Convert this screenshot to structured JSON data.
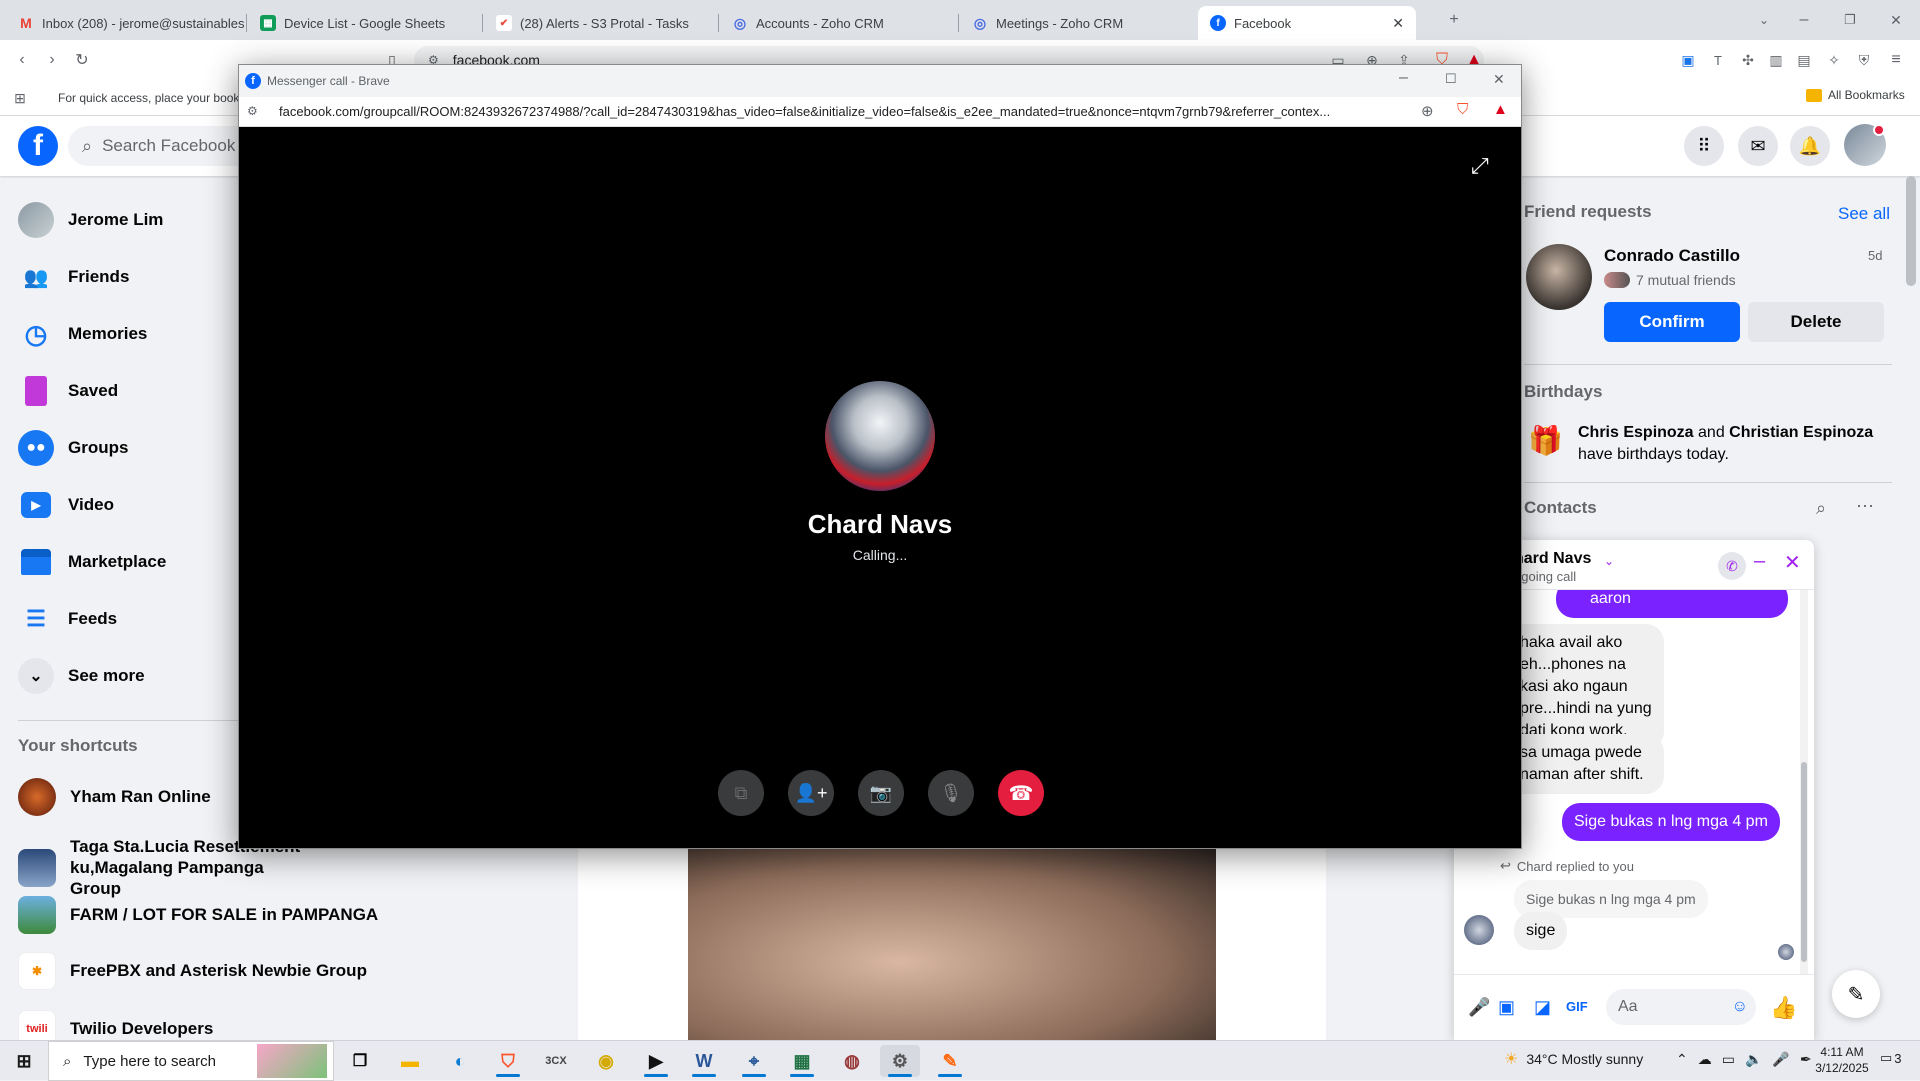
{
  "browser": {
    "tabs": [
      {
        "label": "Inbox (208) - jerome@sustainablesp",
        "icon": "gmail-icon",
        "color": "#ea4335"
      },
      {
        "label": "Device List - Google Sheets",
        "icon": "sheets-icon",
        "color": "#0f9d58"
      },
      {
        "label": "(28) Alerts - S3 Protal - Tasks",
        "icon": "tasks-icon",
        "color": "#e94b3c"
      },
      {
        "label": "Accounts - Zoho CRM",
        "icon": "zoho-icon",
        "color": "#4a6ee0"
      },
      {
        "label": "Meetings - Zoho CRM",
        "icon": "zoho-icon",
        "color": "#4a6ee0"
      },
      {
        "label": "Facebook",
        "icon": "facebook-icon",
        "color": "#0866ff"
      }
    ],
    "address": "facebook.com",
    "bookmarks_hint": "For quick access, place your bookm",
    "all_bookmarks": "All Bookmarks"
  },
  "facebook": {
    "search_placeholder": "Search Facebook",
    "nav": [
      {
        "label": "Jerome Lim",
        "icon": "avatar"
      },
      {
        "label": "Friends",
        "icon": "friends-icon"
      },
      {
        "label": "Memories",
        "icon": "memories-icon"
      },
      {
        "label": "Saved",
        "icon": "saved-icon"
      },
      {
        "label": "Groups",
        "icon": "groups-icon"
      },
      {
        "label": "Video",
        "icon": "video-icon"
      },
      {
        "label": "Marketplace",
        "icon": "marketplace-icon"
      },
      {
        "label": "Feeds",
        "icon": "feeds-icon"
      },
      {
        "label": "See more",
        "icon": "chevron-down-icon"
      }
    ],
    "shortcuts_title": "Your shortcuts",
    "shortcuts": [
      {
        "label": "Yham Ran Online"
      },
      {
        "label": "Taga Sta.Lucia Resettlement ku,Magalang Pampanga Group"
      },
      {
        "label": "FARM / LOT FOR SALE in PAMPANGA"
      },
      {
        "label": "FreePBX and Asterisk Newbie Group"
      },
      {
        "label": "Twilio Developers"
      }
    ],
    "friend_requests": {
      "title": "Friend requests",
      "see_all": "See all",
      "name": "Conrado Castillo",
      "age": "5d",
      "mutual": "7 mutual friends",
      "confirm": "Confirm",
      "delete": "Delete"
    },
    "birthdays": {
      "title": "Birthdays",
      "name1": "Chris Espinoza",
      "and": " and ",
      "name2": "Christian Espinoza",
      "rest": "have birthdays today."
    },
    "contacts_title": "Contacts"
  },
  "chat": {
    "name": "hard Navs",
    "status": "ngoing call",
    "messages": {
      "out_top": "aaron",
      "in1": "haka avail ako eh...phones na kasi ako ngaun pre...hindi na yung dati kong work.",
      "in2": "sa umaga pwede naman after shift.",
      "out1": "Sige bukas n lng mga 4 pm",
      "reply_note": "Chard replied to you",
      "quoted": "Sige bukas n lng mga 4 pm",
      "in3": "sige"
    },
    "composer_placeholder": "Aa"
  },
  "popup": {
    "title": "Messenger call - Brave",
    "url": "facebook.com/groupcall/ROOM:8243932672374988/?call_id=2847430319&has_video=false&initialize_video=false&is_e2ee_mandated=true&nonce=ntqvm7grnb79&referrer_contex...",
    "caller": "Chard Navs",
    "status": "Calling..."
  },
  "taskbar": {
    "search_placeholder": "Type here to search",
    "weather": "34°C  Mostly sunny",
    "time": "4:11 AM",
    "date": "3/12/2025",
    "notifications": "3"
  }
}
